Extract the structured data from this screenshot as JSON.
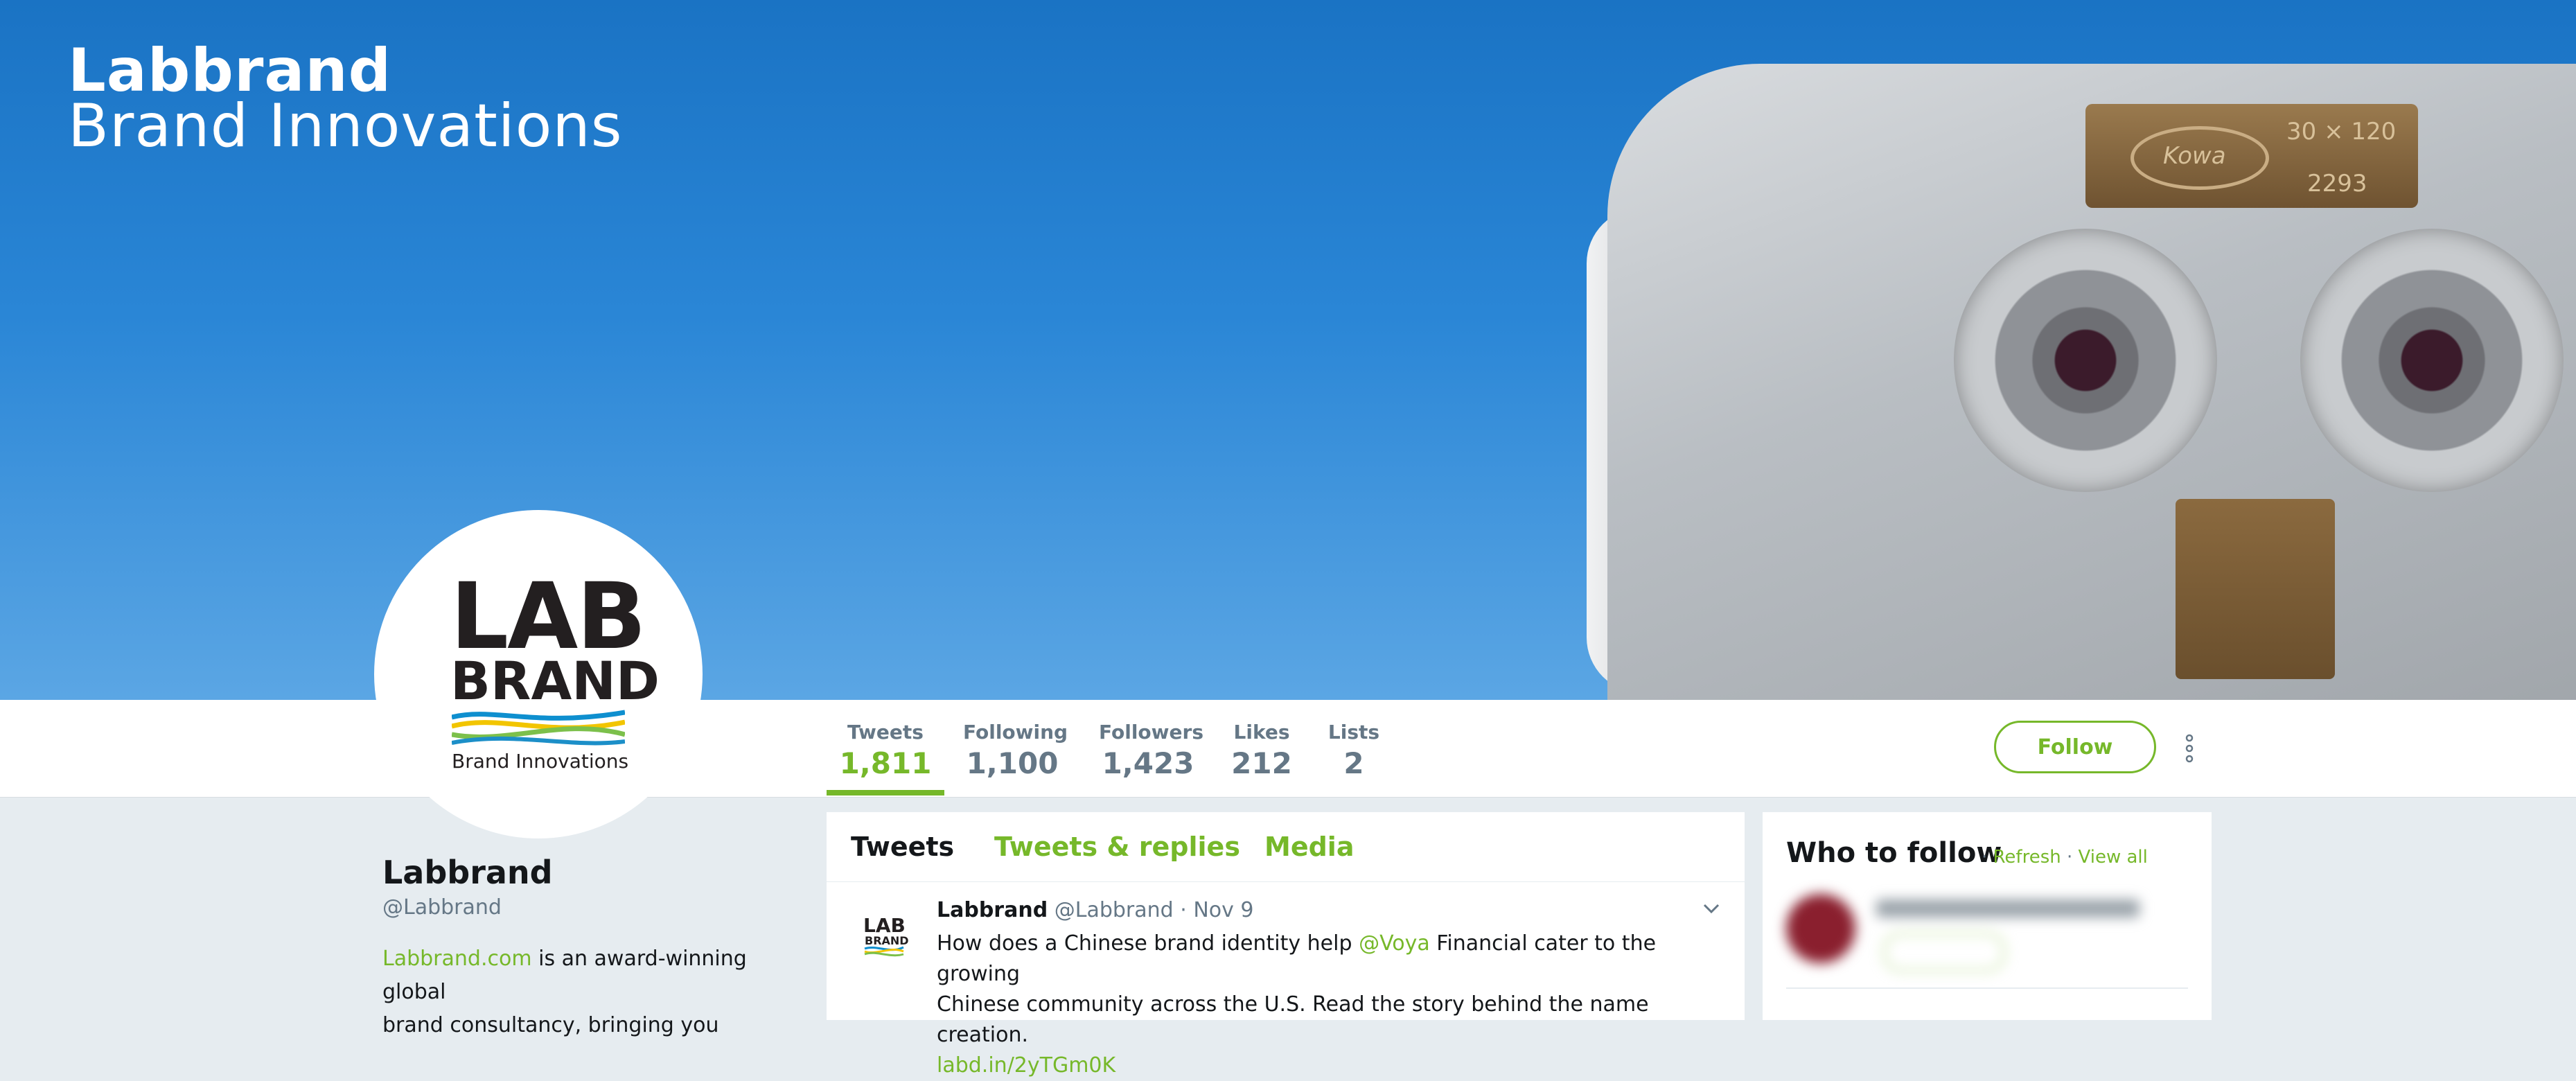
{
  "banner": {
    "brand_name": "Labbrand",
    "brand_tagline": "Brand Innovations",
    "plate_text_1": "30 × 120",
    "plate_text_2": "2293",
    "plate_brand": "Kowa"
  },
  "avatar": {
    "logo_line1": "LAB",
    "logo_line2": "BRAND",
    "logo_sub": "Brand Innovations"
  },
  "stats": [
    {
      "label": "Tweets",
      "value": "1,811"
    },
    {
      "label": "Following",
      "value": "1,100"
    },
    {
      "label": "Followers",
      "value": "1,423"
    },
    {
      "label": "Likes",
      "value": "212"
    },
    {
      "label": "Lists",
      "value": "2"
    }
  ],
  "follow_button": "Follow",
  "profile": {
    "name": "Labbrand",
    "handle": "@Labbrand",
    "bio_link": "Labbrand.com",
    "bio_line1_rest": " is an award-winning global",
    "bio_line2": "brand consultancy, bringing you"
  },
  "timeline": {
    "tabs": [
      "Tweets",
      "Tweets & replies",
      "Media"
    ],
    "tweet": {
      "author": "Labbrand",
      "handle": "@Labbrand",
      "date": "· Nov 9",
      "text_part1": "How does a Chinese brand identity help ",
      "mention": "@Voya",
      "text_part2": " Financial cater to the growing",
      "text_line2": "Chinese community across the U.S. Read the story behind the name creation.",
      "link": "labd.in/2yTGm0K"
    }
  },
  "who_to_follow": {
    "title": "Who to follow",
    "sep1": " · ",
    "refresh": "Refresh",
    "sep2": " · ",
    "view_all": "View all"
  },
  "colors": {
    "accent": "#76b82a",
    "banner_blue": "#2a86d6",
    "muted": "#657786"
  }
}
